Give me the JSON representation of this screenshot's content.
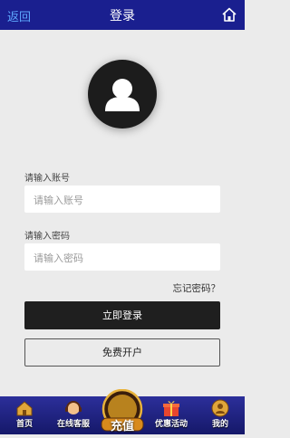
{
  "header": {
    "back_label": "返回",
    "title": "登录",
    "home_icon": "home-icon"
  },
  "form": {
    "account_label": "请输入账号",
    "account_placeholder": "请输入账号",
    "password_label": "请输入密码",
    "password_placeholder": "请输入密码",
    "forgot_label": "忘记密码？",
    "login_label": "立即登录",
    "register_label": "免费开户"
  },
  "tabbar": {
    "items": [
      {
        "label": "首页",
        "icon": "home-tab-icon"
      },
      {
        "label": "在线客服",
        "icon": "support-tab-icon"
      },
      {
        "label": "充值",
        "icon": "recharge-tab-icon"
      },
      {
        "label": "优惠活动",
        "icon": "gift-tab-icon"
      },
      {
        "label": "我的",
        "icon": "profile-tab-icon"
      }
    ]
  },
  "colors": {
    "header_bg": "#1a1f8f",
    "back_text": "#5ea8ff",
    "login_bg": "#1f1f1f",
    "page_bg": "#ebebeb"
  }
}
